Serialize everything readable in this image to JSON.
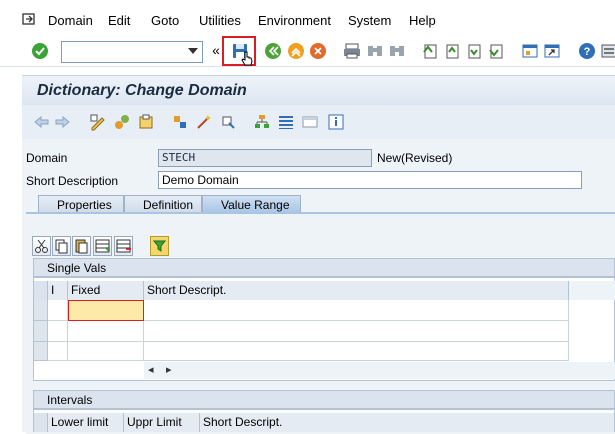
{
  "menu": {
    "items": [
      {
        "label": "Domain"
      },
      {
        "label": "Edit"
      },
      {
        "label": "Goto"
      },
      {
        "label": "Utilities"
      },
      {
        "label": "Environment"
      },
      {
        "label": "System"
      },
      {
        "label": "Help"
      }
    ]
  },
  "toolbar": {
    "command_value": "",
    "nav_back_chevrons": "«"
  },
  "title": "Dictionary: Change Domain",
  "form": {
    "domain_label": "Domain",
    "domain_value": "STECH",
    "domain_status": "New(Revised)",
    "short_desc_label": "Short Description",
    "short_desc_value": "Demo Domain"
  },
  "tabs": [
    {
      "label": "Properties"
    },
    {
      "label": "Definition"
    },
    {
      "label": "Value Range"
    }
  ],
  "single_vals": {
    "title": "Single Vals",
    "columns": [
      "I",
      "Fixed",
      "Short Descript."
    ],
    "scroll_left": "◂",
    "scroll_right": "▸"
  },
  "intervals": {
    "title": "Intervals",
    "columns": [
      "Lower limit",
      "Uppr Limit",
      "Short Descript."
    ]
  },
  "colors": {
    "highlight": "#d81f26",
    "selected_cell": "#fdeaa8"
  }
}
